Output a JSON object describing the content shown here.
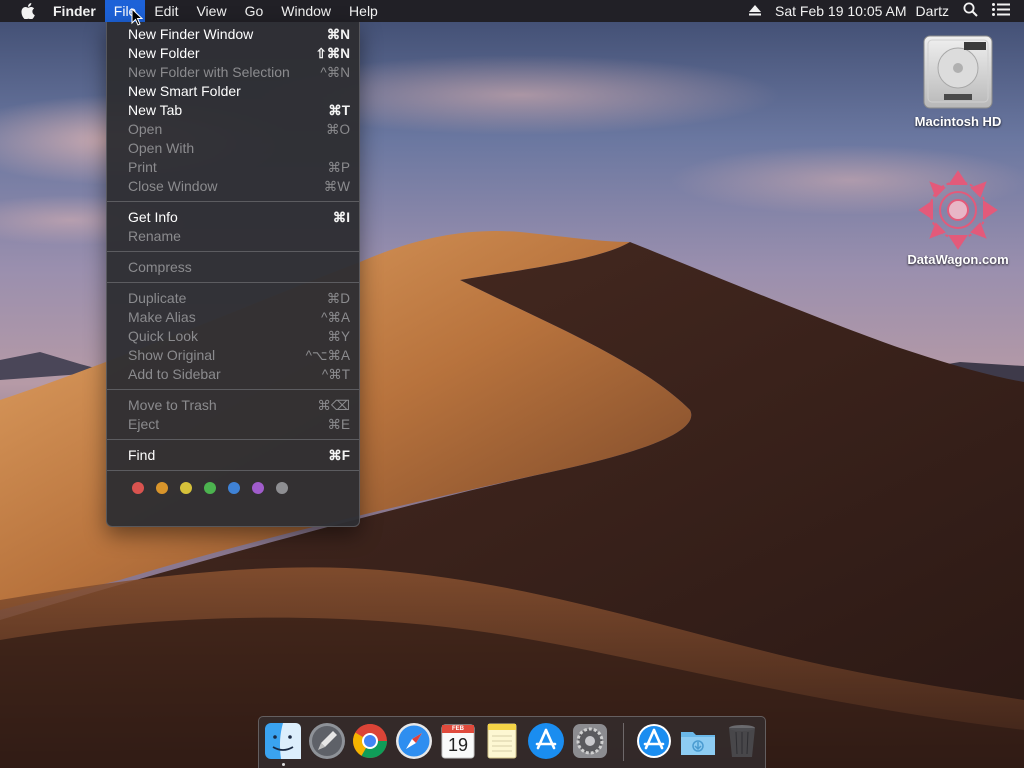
{
  "menubar": {
    "app_name": "Finder",
    "menus": [
      "File",
      "Edit",
      "View",
      "Go",
      "Window",
      "Help"
    ],
    "active_menu": "File",
    "clock": "Sat Feb 19  10:05 AM",
    "user": "Dartz",
    "icons": [
      "apple-icon",
      "eject-icon",
      "spotlight-search-icon",
      "notification-center-icon"
    ]
  },
  "file_menu": {
    "groups": [
      [
        {
          "label": "New Finder Window",
          "shortcut": "⌘N",
          "enabled": true
        },
        {
          "label": "New Folder",
          "shortcut": "⇧⌘N",
          "enabled": true
        },
        {
          "label": "New Folder with Selection",
          "shortcut": "^⌘N",
          "enabled": false
        },
        {
          "label": "New Smart Folder",
          "shortcut": "",
          "enabled": true
        },
        {
          "label": "New Tab",
          "shortcut": "⌘T",
          "enabled": true
        },
        {
          "label": "Open",
          "shortcut": "⌘O",
          "enabled": false
        },
        {
          "label": "Open With",
          "shortcut": "",
          "enabled": false
        },
        {
          "label": "Print",
          "shortcut": "⌘P",
          "enabled": false
        },
        {
          "label": "Close Window",
          "shortcut": "⌘W",
          "enabled": false
        }
      ],
      [
        {
          "label": "Get Info",
          "shortcut": "⌘I",
          "enabled": true
        },
        {
          "label": "Rename",
          "shortcut": "",
          "enabled": false
        }
      ],
      [
        {
          "label": "Compress",
          "shortcut": "",
          "enabled": false
        }
      ],
      [
        {
          "label": "Duplicate",
          "shortcut": "⌘D",
          "enabled": false
        },
        {
          "label": "Make Alias",
          "shortcut": "^⌘A",
          "enabled": false
        },
        {
          "label": "Quick Look",
          "shortcut": "⌘Y",
          "enabled": false
        },
        {
          "label": "Show Original",
          "shortcut": "^⌥⌘A",
          "enabled": false
        },
        {
          "label": "Add to Sidebar",
          "shortcut": "^⌘T",
          "enabled": false
        }
      ],
      [
        {
          "label": "Move to Trash",
          "shortcut": "⌘⌫",
          "enabled": false
        },
        {
          "label": "Eject",
          "shortcut": "⌘E",
          "enabled": false
        }
      ],
      [
        {
          "label": "Find",
          "shortcut": "⌘F",
          "enabled": true
        }
      ]
    ],
    "tag_colors": [
      "#d9534f",
      "#d9952b",
      "#d6c13a",
      "#4cb34f",
      "#3f82d6",
      "#a05ccb",
      "#8e8e92"
    ]
  },
  "desktop": {
    "icons": [
      {
        "label": "Macintosh HD",
        "icon": "hard-drive-icon"
      },
      {
        "label": "DataWagon.com",
        "icon": "mandala-icon"
      }
    ]
  },
  "dock": {
    "apps": [
      {
        "name": "Finder",
        "icon": "finder-icon",
        "running": true
      },
      {
        "name": "Launchpad",
        "icon": "launchpad-icon",
        "running": false
      },
      {
        "name": "Google Chrome",
        "icon": "chrome-icon",
        "running": false
      },
      {
        "name": "Safari",
        "icon": "safari-icon",
        "running": false
      },
      {
        "name": "Calendar",
        "icon": "calendar-icon",
        "running": false,
        "month": "FEB",
        "day": "19"
      },
      {
        "name": "Notes",
        "icon": "notes-icon",
        "running": false
      },
      {
        "name": "App Store",
        "icon": "app-store-icon",
        "running": false
      },
      {
        "name": "System Preferences",
        "icon": "system-preferences-icon",
        "running": false
      },
      {
        "name": "App Store Downloads",
        "icon": "app-store-icon",
        "running": false
      },
      {
        "name": "Downloads",
        "icon": "downloads-folder-icon",
        "running": false
      },
      {
        "name": "Trash",
        "icon": "trash-icon",
        "running": false
      }
    ]
  },
  "colors": {
    "menu_highlight": "#1d62d8",
    "menu_bg": "#2e2e32",
    "disabled_text": "#8b8b8e"
  }
}
